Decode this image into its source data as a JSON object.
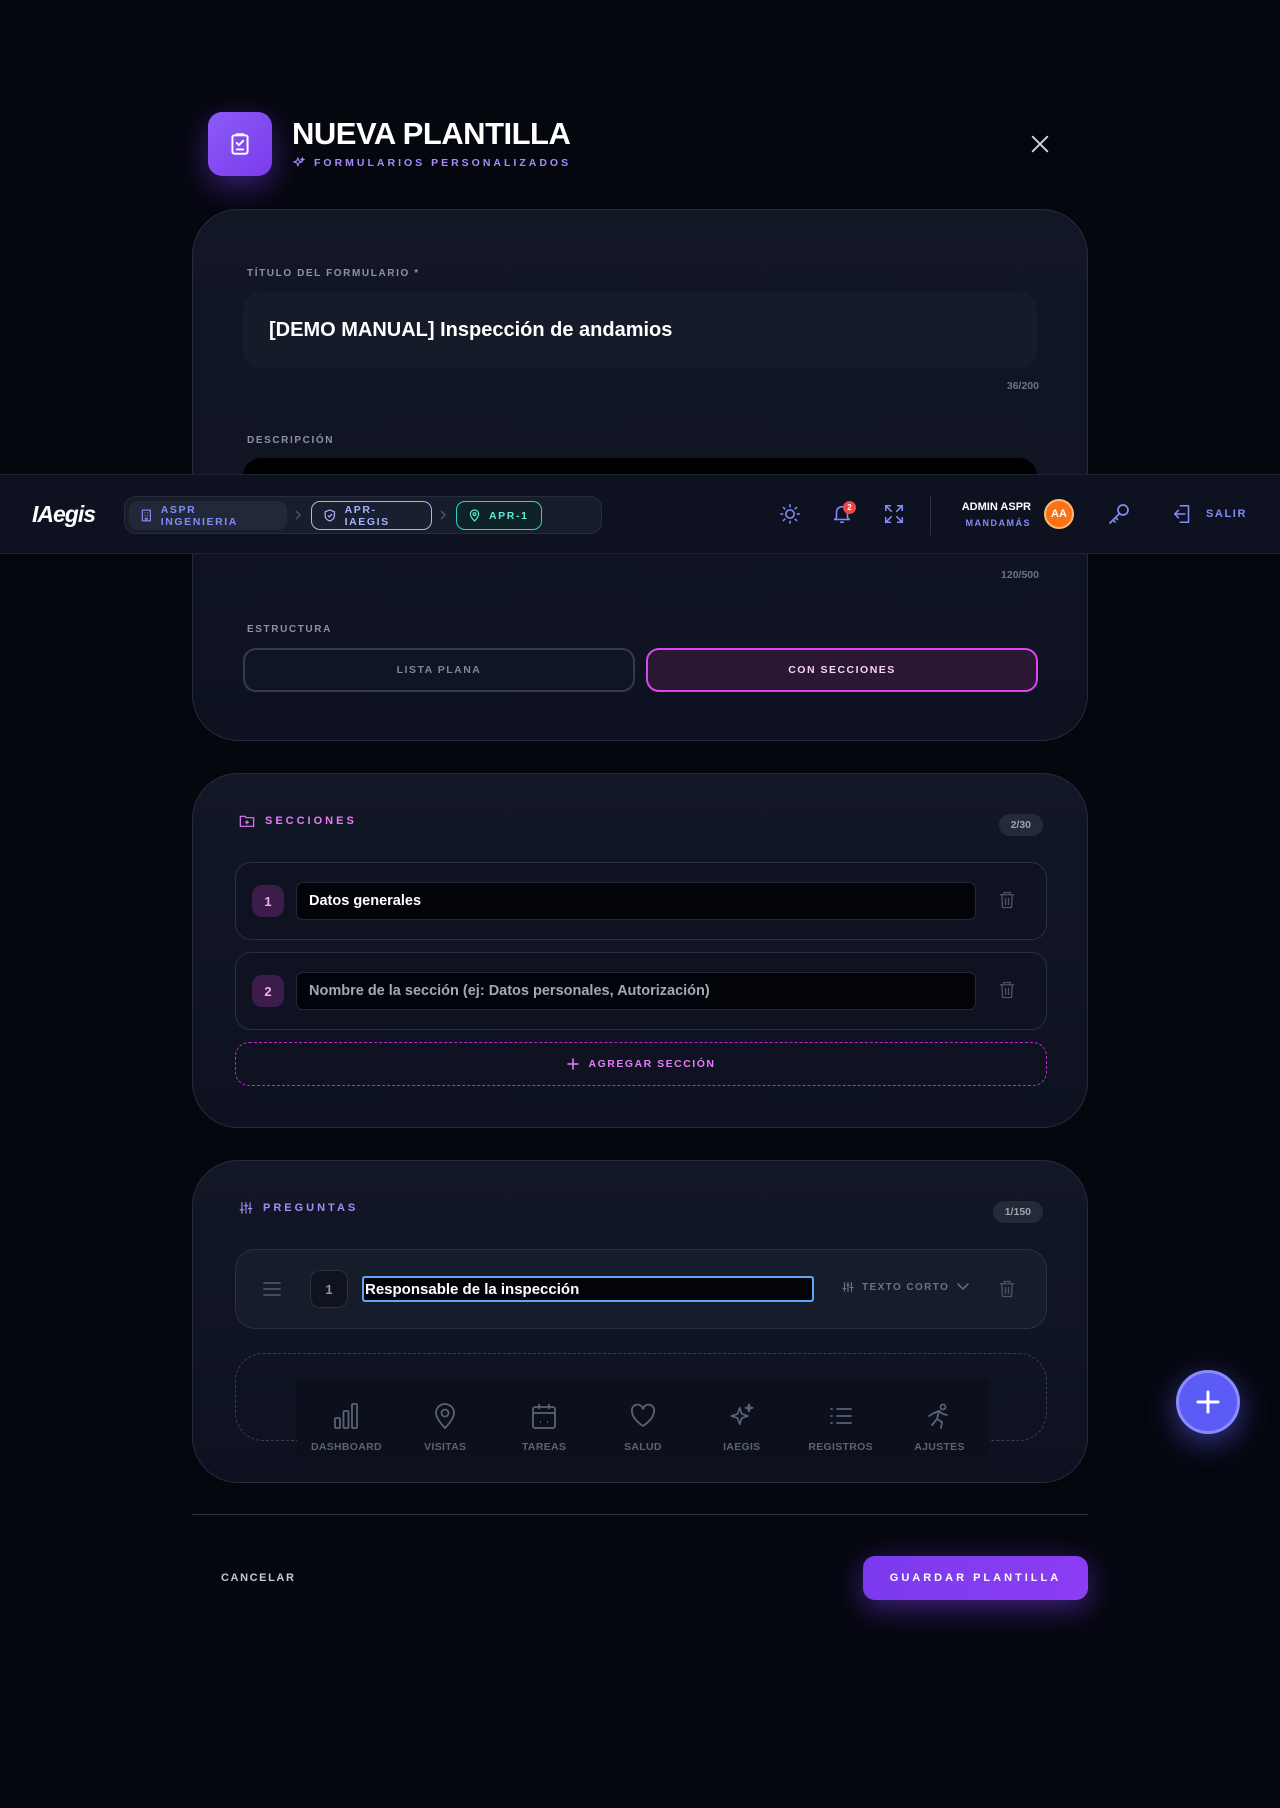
{
  "modal": {
    "title": "NUEVA PLANTILLA",
    "subtitle": "FORMULARIOS PERSONALIZADOS"
  },
  "form": {
    "title_label": "TÍTULO DEL FORMULARIO *",
    "title_value": "[DEMO MANUAL] Inspección de andamios",
    "title_counter": "36/200",
    "description_label": "DESCRIPCIÓN",
    "description_counter": "120/500",
    "structure_label": "ESTRUCTURA",
    "structure_options": [
      "LISTA PLANA",
      "CON SECCIONES"
    ],
    "structure_selected": "CON SECCIONES"
  },
  "sections": {
    "heading": "SECCIONES",
    "count": "2/30",
    "items": [
      {
        "number": "1",
        "value": "Datos generales",
        "placeholder": ""
      },
      {
        "number": "2",
        "value": "",
        "placeholder": "Nombre de la sección (ej: Datos personales, Autorización)"
      }
    ],
    "add_label": "AGREGAR SECCIÓN"
  },
  "questions": {
    "heading": "PREGUNTAS",
    "count": "1/150",
    "items": [
      {
        "number": "1",
        "value": "Responsable de la inspección",
        "type": "TEXTO CORTO"
      }
    ]
  },
  "bottom_nav": [
    {
      "label": "DASHBOARD",
      "icon": "bar-chart-icon"
    },
    {
      "label": "VISITAS",
      "icon": "map-pin-icon"
    },
    {
      "label": "TAREAS",
      "icon": "calendar-icon"
    },
    {
      "label": "SALUD",
      "icon": "heart-icon"
    },
    {
      "label": "IAEGIS",
      "icon": "sparkles-icon"
    },
    {
      "label": "REGISTROS",
      "icon": "list-icon"
    },
    {
      "label": "AJUSTES",
      "icon": "runner-icon"
    }
  ],
  "footer": {
    "cancel_label": "CANCELAR",
    "save_label": "GUARDAR PLANTILLA"
  },
  "topbar": {
    "logo": "IAegis",
    "breadcrumbs": [
      "ASPR INGENIERIA",
      "APR-IAEGIS",
      "APR-1"
    ],
    "notification_count": "2",
    "user_name": "ADMIN ASPR",
    "user_role": "MANDAMÁS",
    "avatar_initials": "AA",
    "logout_label": "SALIR"
  },
  "colors": {
    "accent_purple": "#7c3aed",
    "accent_magenta": "#d946ef",
    "accent_indigo": "#818cf8",
    "accent_teal": "#2dd4bf",
    "background": "#05070f"
  }
}
